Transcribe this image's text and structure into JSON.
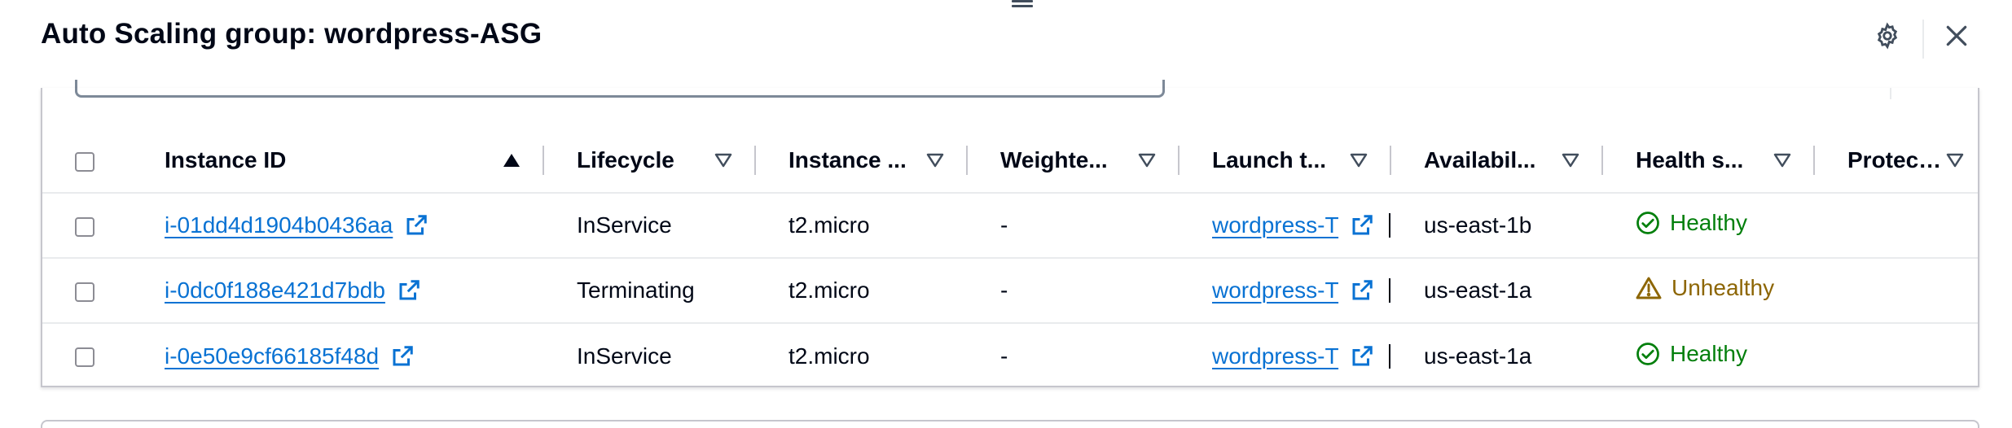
{
  "header": {
    "title": "Auto Scaling group: wordpress-ASG",
    "settings_icon": "gear-icon",
    "close_icon": "close-icon"
  },
  "table": {
    "columns": [
      {
        "label": "Instance ID",
        "sort": "ascending"
      },
      {
        "label": "Lifecycle",
        "sort": "none"
      },
      {
        "label": "Instance ...",
        "sort": "none"
      },
      {
        "label": "Weighte...",
        "sort": "none"
      },
      {
        "label": "Launch t...",
        "sort": "none"
      },
      {
        "label": "Availabil...",
        "sort": "none"
      },
      {
        "label": "Health s...",
        "sort": "none"
      },
      {
        "label": "Protecte...",
        "sort": "none"
      }
    ],
    "rows": [
      {
        "instance_id": "i-01dd4d1904b0436aa",
        "lifecycle": "InService",
        "instance_type": "t2.micro",
        "weighted": "-",
        "launch_template": "wordpress-T",
        "az": "us-east-1b",
        "health": "Healthy",
        "health_state": "healthy",
        "protected": ""
      },
      {
        "instance_id": "i-0dc0f188e421d7bdb",
        "lifecycle": "Terminating",
        "instance_type": "t2.micro",
        "weighted": "-",
        "launch_template": "wordpress-T",
        "az": "us-east-1a",
        "health": "Unhealthy",
        "health_state": "unhealthy",
        "protected": ""
      },
      {
        "instance_id": "i-0e50e9cf66185f48d",
        "lifecycle": "InService",
        "instance_type": "t2.micro",
        "weighted": "-",
        "launch_template": "wordpress-T",
        "az": "us-east-1a",
        "health": "Healthy",
        "health_state": "healthy",
        "protected": ""
      }
    ]
  },
  "colors": {
    "link": "#0972d3",
    "healthy": "#037f0c",
    "unhealthy": "#8d6605",
    "text": "#000716",
    "border": "#c6c6cd"
  }
}
